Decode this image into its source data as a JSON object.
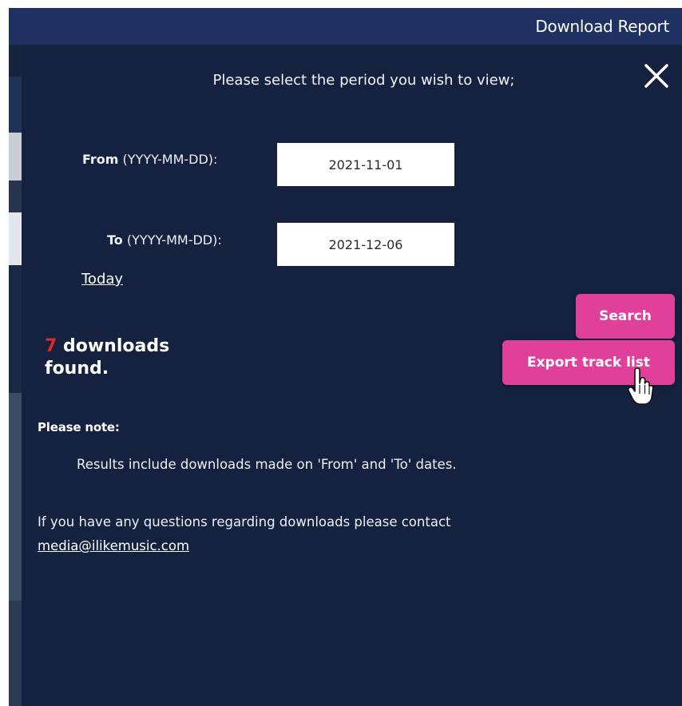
{
  "header": {
    "title": "Download Report"
  },
  "modal": {
    "prompt": "Please select the period you wish to view;",
    "from": {
      "label_strong": "From",
      "label_format": " (YYYY-MM-DD):",
      "value": "2021-11-01"
    },
    "to": {
      "label_strong": "To",
      "label_format": " (YYYY-MM-DD):",
      "value": "2021-12-06"
    },
    "today_link": "Today",
    "search_button": "Search",
    "export_button": "Export track list",
    "result": {
      "count": "7",
      "text_line1": " downloads",
      "text_line2": "found."
    },
    "note": {
      "title": "Please note:",
      "body": "Results include downloads made on 'From' and 'To' dates."
    },
    "contact": {
      "text": "If you have any questions regarding downloads please contact",
      "email": "media@ilikemusic.com"
    }
  },
  "colors": {
    "header_bg": "#1e3160",
    "modal_bg": "#14213f",
    "button_accent": "#e0409a",
    "count_red": "#e3262c"
  },
  "icons": {
    "close": "close-icon",
    "cursor": "hand-pointer-icon"
  }
}
